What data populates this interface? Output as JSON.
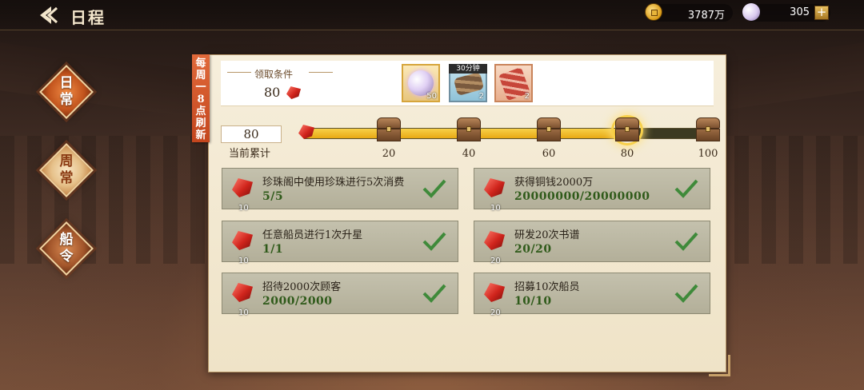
{
  "header": {
    "title": "日程",
    "coins": "3787万",
    "pearls": "305",
    "add_symbol": "+"
  },
  "tabs": [
    {
      "label": "日\n常",
      "name": "daily",
      "state": "active"
    },
    {
      "label": "周\n常",
      "name": "weekly",
      "state": "highlight"
    },
    {
      "label": "船\n令",
      "name": "ship-order",
      "state": "inactive"
    }
  ],
  "panel": {
    "refresh_ribbon": "每周一8点刷新",
    "condition_title": "领取条件",
    "condition_amount": "80",
    "rewards": [
      {
        "icon": "pearl-icon",
        "count": "50"
      },
      {
        "icon": "wood-icon",
        "count": "2",
        "tag": "30分钟"
      },
      {
        "icon": "meat-icon",
        "count": "2"
      }
    ],
    "current_value": "80",
    "current_label": "当前累计",
    "progress": {
      "current": 80,
      "max": 100,
      "milestones": [
        "20",
        "40",
        "60",
        "80",
        "100"
      ]
    },
    "tasks": [
      {
        "title": "珍珠阁中使用珍珠进行5次消费",
        "progress": "5/5",
        "points": "10",
        "done": true
      },
      {
        "title": "获得铜钱2000万",
        "progress": "20000000/20000000",
        "points": "10",
        "done": true
      },
      {
        "title": "任意船员进行1次升星",
        "progress": "1/1",
        "points": "10",
        "done": true
      },
      {
        "title": "研发20次书谱",
        "progress": "20/20",
        "points": "20",
        "done": true
      },
      {
        "title": "招待2000次顾客",
        "progress": "2000/2000",
        "points": "10",
        "done": true
      },
      {
        "title": "招募10次船员",
        "progress": "10/10",
        "points": "20",
        "done": true
      }
    ]
  },
  "colors": {
    "accent": "#e8a914",
    "done_check": "#3f8a3a",
    "tab_active": "#c2541d"
  }
}
